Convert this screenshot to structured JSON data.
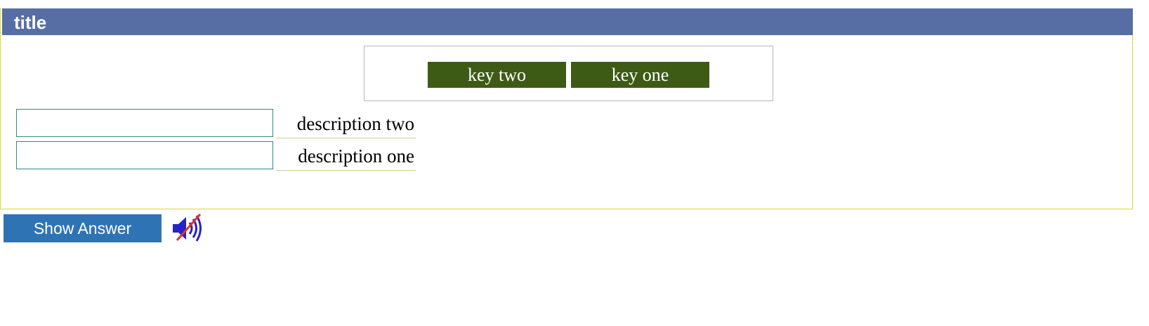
{
  "header": {
    "title": "title"
  },
  "keys": [
    {
      "label": "key two"
    },
    {
      "label": "key one"
    }
  ],
  "rows": [
    {
      "input_value": "",
      "description": "description two"
    },
    {
      "input_value": "",
      "description": "description one"
    }
  ],
  "controls": {
    "show_answer_label": "Show Answer",
    "audio_icon": "speaker-muted-icon"
  },
  "colors": {
    "title_bar": "#566ea4",
    "key_tile": "#3e5b16",
    "show_answer_button": "#2e74b5",
    "panel_border": "#d9d926",
    "input_border": "#2f8a7c"
  }
}
